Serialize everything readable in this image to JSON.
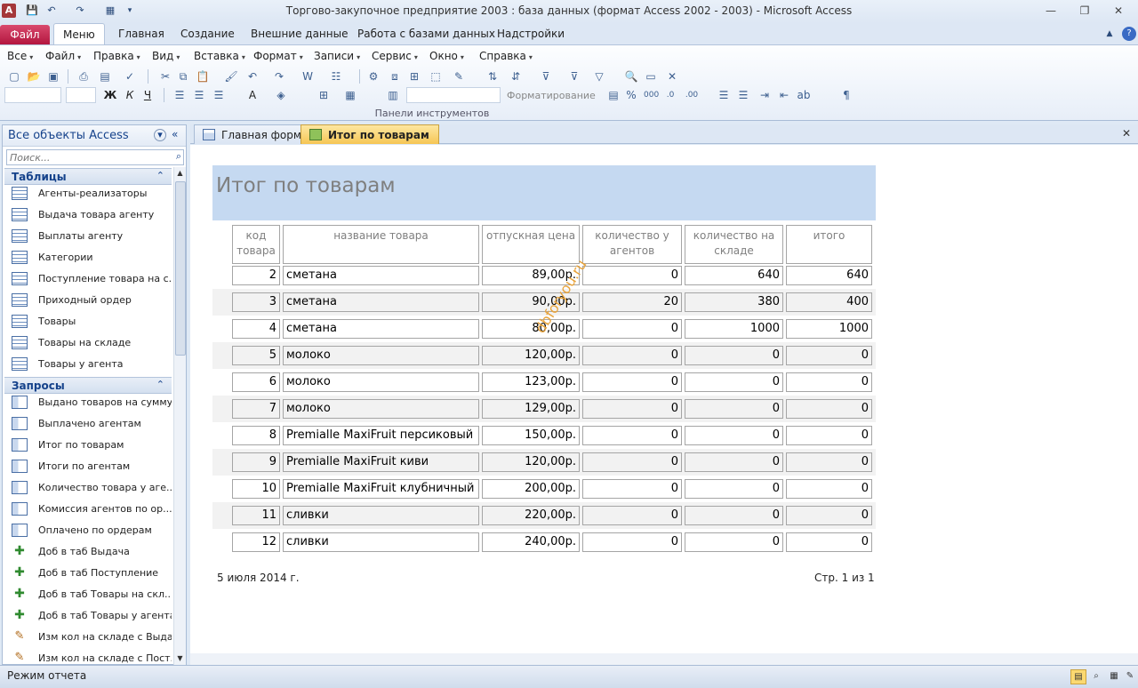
{
  "window": {
    "title": "Торгово-закупочное предприятие 2003 : база данных (формат Access 2002 - 2003)  -  Microsoft Access"
  },
  "ribbon_tabs": [
    "Файл",
    "Меню",
    "Главная",
    "Создание",
    "Внешние данные",
    "Работа с базами данных",
    "Надстройки"
  ],
  "menu": [
    "Все",
    "Файл",
    "Правка",
    "Вид",
    "Вставка",
    "Формат",
    "Записи",
    "Сервис",
    "Окно",
    "Справка"
  ],
  "toolbar": {
    "format_label": "Форматирование",
    "group_label": "Панели инструментов"
  },
  "nav": {
    "title": "Все объекты Access",
    "search_placeholder": "Поиск...",
    "tables_label": "Таблицы",
    "tables": [
      "Агенты-реализаторы",
      "Выдача товара агенту",
      "Выплаты агенту",
      "Категории",
      "Поступление товара на с...",
      "Приходный ордер",
      "Товары",
      "Товары на складе",
      "Товары у агента"
    ],
    "queries_label": "Запросы",
    "queries": [
      {
        "label": "Выдано товаров на сумму",
        "icon": "query-icon"
      },
      {
        "label": "Выплачено агентам",
        "icon": "query-icon"
      },
      {
        "label": "Итог по товарам",
        "icon": "query-icon"
      },
      {
        "label": "Итоги по агентам",
        "icon": "query-icon"
      },
      {
        "label": "Количество товара у аге...",
        "icon": "query-icon"
      },
      {
        "label": "Комиссия агентов по ор...",
        "icon": "query-icon"
      },
      {
        "label": "Оплачено по ордерам",
        "icon": "query-icon"
      },
      {
        "label": "Доб в таб Выдача",
        "icon": "append-query-icon"
      },
      {
        "label": "Доб в таб Поступление",
        "icon": "append-query-icon"
      },
      {
        "label": "Доб в таб Товары на скл...",
        "icon": "append-query-icon"
      },
      {
        "label": "Доб в таб Товары у агента",
        "icon": "append-query-icon"
      },
      {
        "label": "Изм кол на складе с Выда...",
        "icon": "update-query-icon"
      },
      {
        "label": "Изм кол на складе с Пост...",
        "icon": "update-query-icon"
      }
    ]
  },
  "doc_tabs": [
    "Главная форма",
    "Итог по товарам"
  ],
  "report": {
    "title": "Итог по товарам",
    "columns": [
      "код товара",
      "название товара",
      "отпускная цена",
      "количество у агентов",
      "количество на складе",
      "итого"
    ],
    "rows": [
      [
        "2",
        "сметана",
        "89,00р.",
        "0",
        "640",
        "640"
      ],
      [
        "3",
        "сметана",
        "90,00р.",
        "20",
        "380",
        "400"
      ],
      [
        "4",
        "сметана",
        "80,00р.",
        "0",
        "1000",
        "1000"
      ],
      [
        "5",
        "молоко",
        "120,00р.",
        "0",
        "0",
        "0"
      ],
      [
        "6",
        "молоко",
        "123,00р.",
        "0",
        "0",
        "0"
      ],
      [
        "7",
        "молоко",
        "129,00р.",
        "0",
        "0",
        "0"
      ],
      [
        "8",
        "Premialle MaxiFruit персиковый",
        "150,00р.",
        "0",
        "0",
        "0"
      ],
      [
        "9",
        "Premialle MaxiFruit киви",
        "120,00р.",
        "0",
        "0",
        "0"
      ],
      [
        "10",
        "Premialle MaxiFruit клубничный",
        "200,00р.",
        "0",
        "0",
        "0"
      ],
      [
        "11",
        "сливки",
        "220,00р.",
        "0",
        "0",
        "0"
      ],
      [
        "12",
        "сливки",
        "240,00р.",
        "0",
        "0",
        "0"
      ]
    ],
    "footer_date": "5 июля 2014 г.",
    "footer_page": "Стр. 1 из 1",
    "watermark": "dbforyou.ru"
  },
  "status": {
    "text": "Режим отчета"
  },
  "colors": {
    "accent": "#c5d9f1",
    "file_tab": "#b3163f",
    "active_tab": "#f6c655"
  }
}
